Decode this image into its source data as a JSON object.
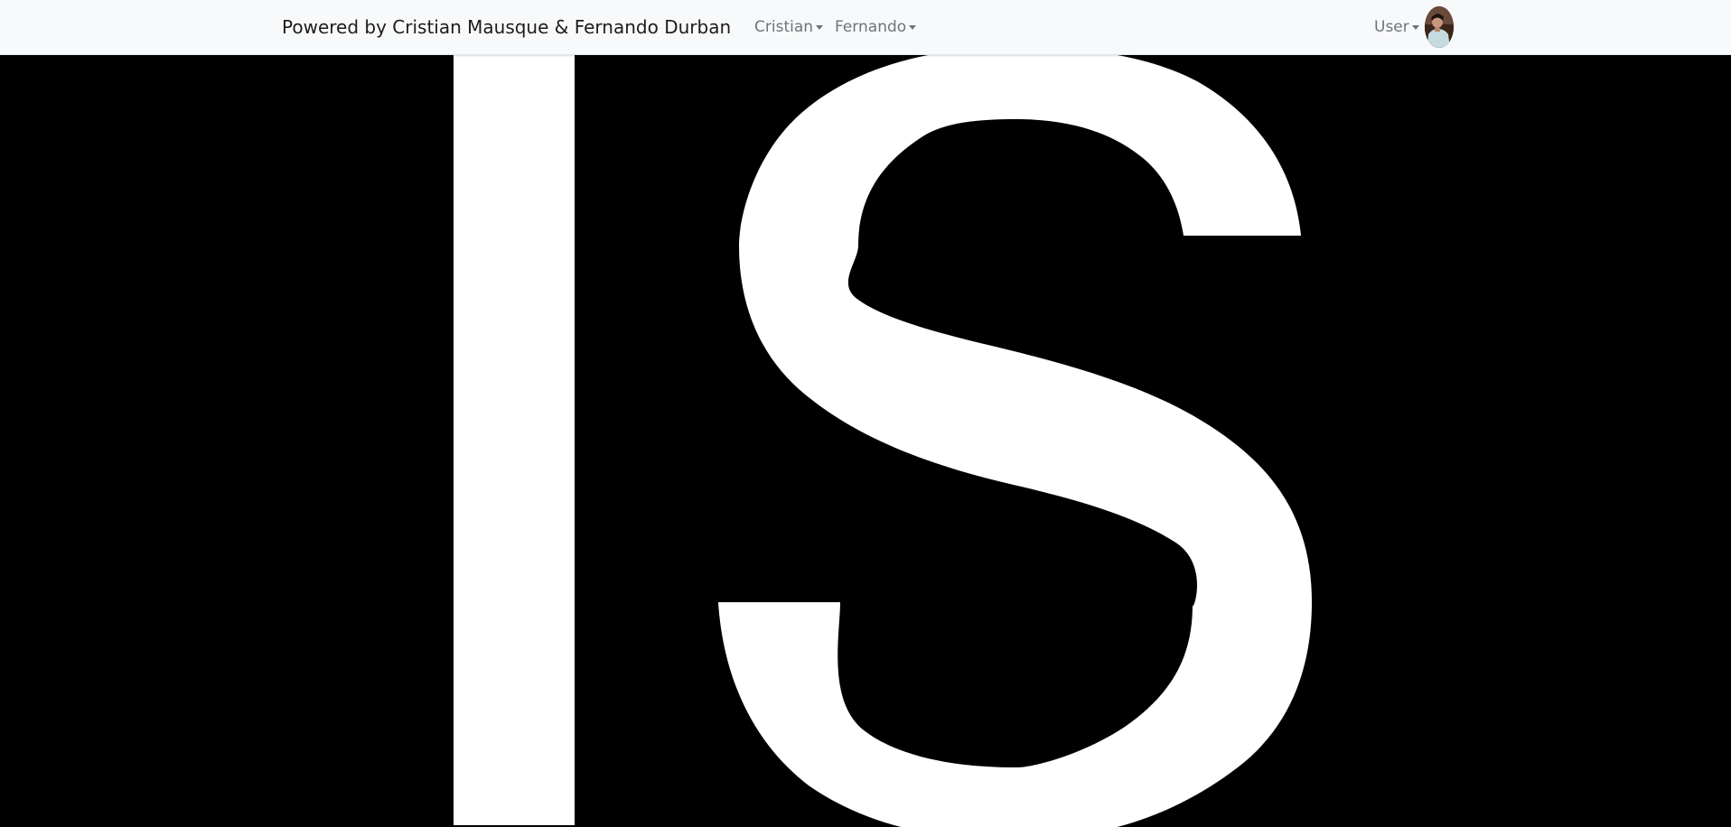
{
  "navbar": {
    "brand": "Powered by Cristian Mausque & Fernando Durban",
    "menus": [
      {
        "label": "Cristian"
      },
      {
        "label": "Fernando"
      }
    ],
    "user_menu": {
      "label": "User"
    },
    "avatar": {
      "icon": "user-avatar-photo"
    }
  },
  "hero": {
    "text": "IS",
    "text_color": "#ffffff",
    "background": "#000000"
  }
}
